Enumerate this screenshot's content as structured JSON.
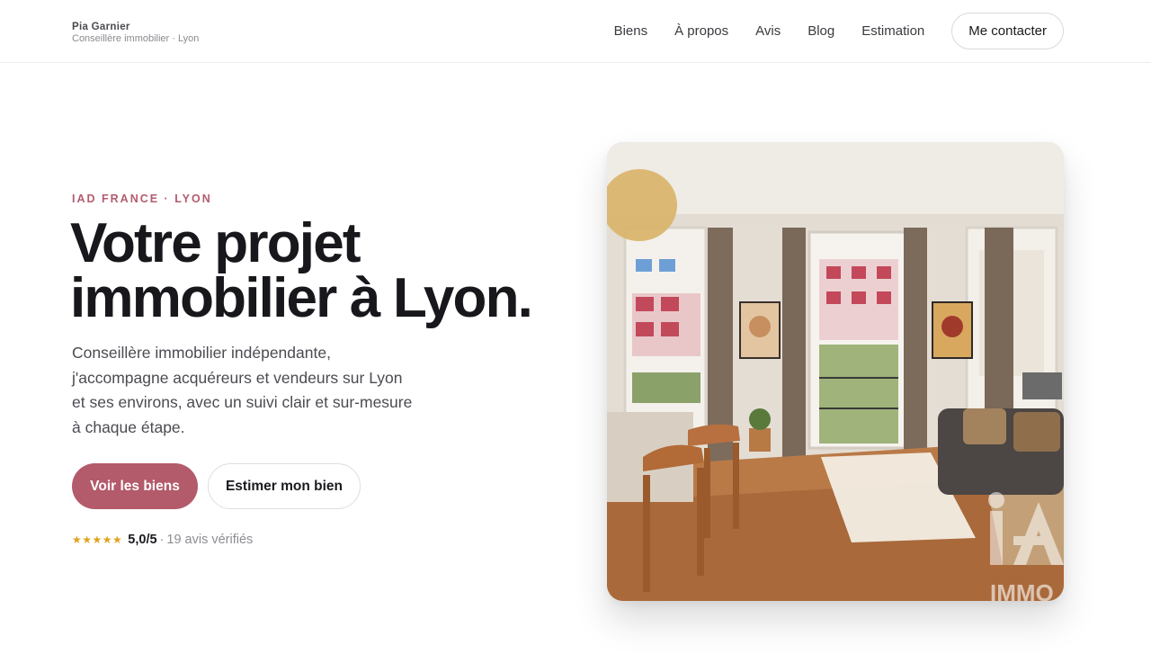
{
  "header": {
    "brand_name": "Pia Garnier",
    "brand_subtitle": "Conseillère immobilier · Lyon",
    "nav": [
      "Biens",
      "À propos",
      "Avis",
      "Blog",
      "Estimation"
    ],
    "contact_label": "Me contacter"
  },
  "hero": {
    "eyebrow": "IAD FRANCE · LYON",
    "title_line1": "Votre projet",
    "title_line2": "immobilier à Lyon.",
    "lede": "Conseillère immobilier indépendante, j'accompagne acquéreurs et vendeurs sur Lyon et ses environs, avec un suivi clair et sur-mesure à chaque étape.",
    "primary_cta": "Voir les biens",
    "secondary_cta": "Estimer mon bien",
    "rating": {
      "stars": "★★★★★",
      "score": "5,0/5",
      "separator": "·",
      "reviews": "19 avis vérifiés"
    }
  },
  "photo": {
    "subject": "apartment-living-room",
    "watermark": "iAD IMMO"
  },
  "colors": {
    "accent": "#b35a6b",
    "eyebrow": "#b35c6e",
    "star": "#e0a31c",
    "text": "#17171c"
  }
}
